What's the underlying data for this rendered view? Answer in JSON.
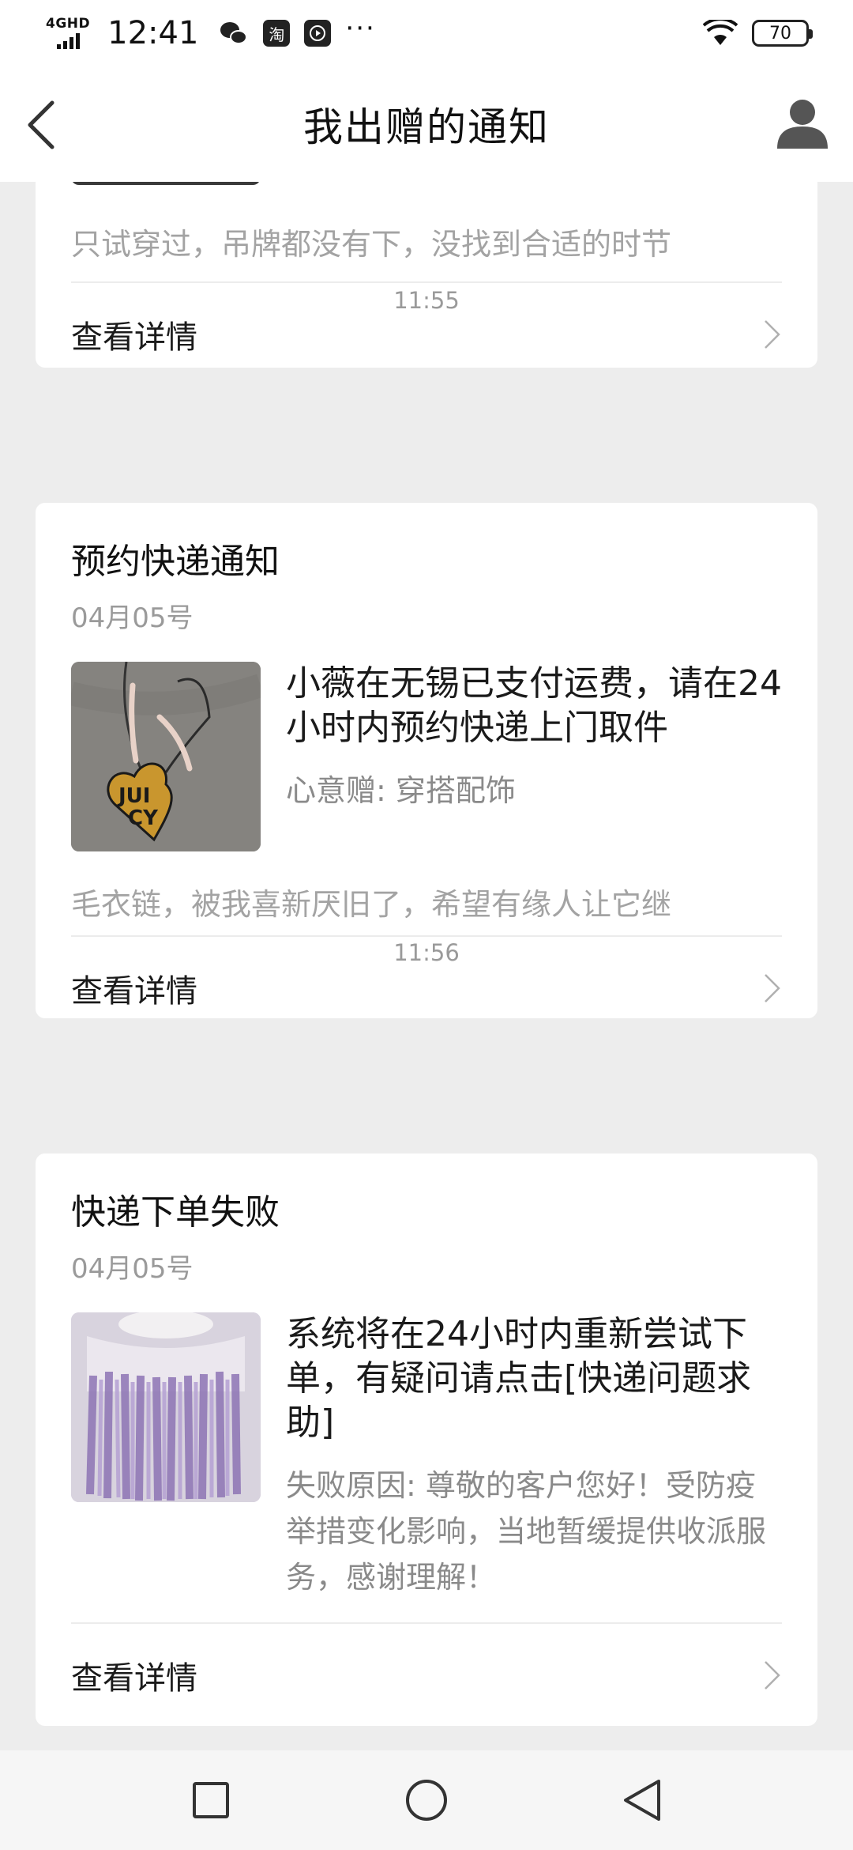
{
  "status_bar": {
    "network": "4GHD",
    "time": "12:41",
    "apps": [
      "wechat-icon",
      "taobao-icon",
      "video-icon"
    ],
    "taobao_label": "淘",
    "more": "···",
    "battery": "70"
  },
  "header": {
    "title": "我出赠的通知"
  },
  "cards": [
    {
      "description": "只试穿过，吊牌都没有下，没找到合适的时节",
      "detail_label": "查看详情"
    },
    {
      "time": "11:55",
      "title": "预约快递通知",
      "date": "04月05号",
      "message": "小薇在无锡已支付运费，请在24小时内预约快递上门取件",
      "sub": "心意赠: 穿搭配饰",
      "description": "毛衣链，被我喜新厌旧了，希望有缘人让它继",
      "detail_label": "查看详情"
    },
    {
      "time": "11:56",
      "title": "快递下单失败",
      "date": "04月05号",
      "message": "系统将在24小时内重新尝试下单，有疑问请点击[快递问题求助]",
      "sub": "失败原因: 尊敬的客户您好！受防疫举措变化影响，当地暂缓提供收派服务，感谢理解！",
      "detail_label": "查看详情"
    }
  ],
  "thumb_texts": [
    "JUI",
    "CY"
  ],
  "colors": {
    "background": "#ededed",
    "card": "#ffffff",
    "secondary_text": "#9a9a9a"
  }
}
